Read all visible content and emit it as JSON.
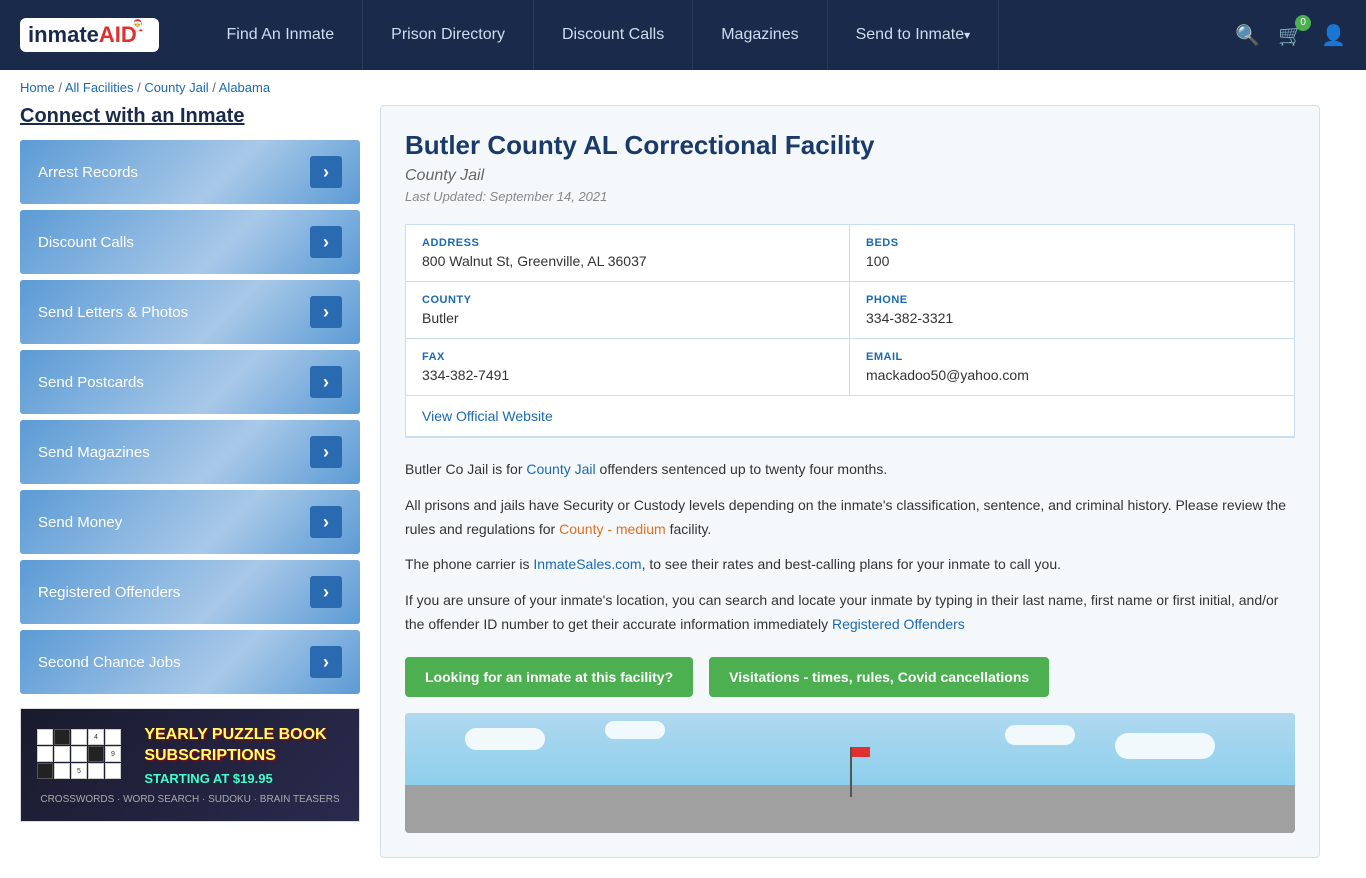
{
  "nav": {
    "logo_text": "inmate",
    "logo_aid": "AID",
    "links": [
      {
        "label": "Find An Inmate",
        "id": "find-inmate",
        "arrow": false
      },
      {
        "label": "Prison Directory",
        "id": "prison-directory",
        "arrow": false
      },
      {
        "label": "Discount Calls",
        "id": "discount-calls",
        "arrow": false
      },
      {
        "label": "Magazines",
        "id": "magazines",
        "arrow": false
      },
      {
        "label": "Send to Inmate",
        "id": "send-to-inmate",
        "arrow": true
      }
    ],
    "cart_count": "0"
  },
  "breadcrumb": {
    "items": [
      {
        "label": "Home",
        "href": "#"
      },
      {
        "label": "All Facilities",
        "href": "#"
      },
      {
        "label": "County Jail",
        "href": "#"
      },
      {
        "label": "Alabama",
        "href": "#"
      }
    ]
  },
  "sidebar": {
    "title": "Connect with an Inmate",
    "items": [
      {
        "label": "Arrest Records",
        "id": "arrest-records"
      },
      {
        "label": "Discount Calls",
        "id": "discount-calls"
      },
      {
        "label": "Send Letters & Photos",
        "id": "send-letters"
      },
      {
        "label": "Send Postcards",
        "id": "send-postcards"
      },
      {
        "label": "Send Magazines",
        "id": "send-magazines"
      },
      {
        "label": "Send Money",
        "id": "send-money"
      },
      {
        "label": "Registered Offenders",
        "id": "registered-offenders"
      },
      {
        "label": "Second Chance Jobs",
        "id": "second-chance-jobs"
      }
    ],
    "ad": {
      "title": "YEARLY PUZZLE BOOK\nSUBSCRIPTIONS",
      "subtitle": "STARTING AT $19.95",
      "types": "CROSSWORDS · WORD SEARCH · SUDOKU · BRAIN TEASERS"
    }
  },
  "facility": {
    "title": "Butler County AL Correctional Facility",
    "type": "County Jail",
    "last_updated": "Last Updated: September 14, 2021",
    "address_label": "ADDRESS",
    "address": "800 Walnut St, Greenville, AL 36037",
    "beds_label": "BEDS",
    "beds": "100",
    "county_label": "COUNTY",
    "county": "Butler",
    "phone_label": "PHONE",
    "phone": "334-382-3321",
    "fax_label": "FAX",
    "fax": "334-382-7491",
    "email_label": "EMAIL",
    "email": "mackadoo50@yahoo.com",
    "official_link": "View Official Website",
    "desc1": "Butler Co Jail is for County Jail offenders sentenced up to twenty four months.",
    "desc2": "All prisons and jails have Security or Custody levels depending on the inmate's classification, sentence, and criminal history. Please review the rules and regulations for County - medium facility.",
    "desc3": "The phone carrier is InmateSales.com, to see their rates and best-calling plans for your inmate to call you.",
    "desc4": "If you are unsure of your inmate's location, you can search and locate your inmate by typing in their last name, first name or first initial, and/or the offender ID number to get their accurate information immediately Registered Offenders",
    "btn_inmate": "Looking for an inmate at this facility?",
    "btn_visitation": "Visitations - times, rules, Covid cancellations"
  }
}
